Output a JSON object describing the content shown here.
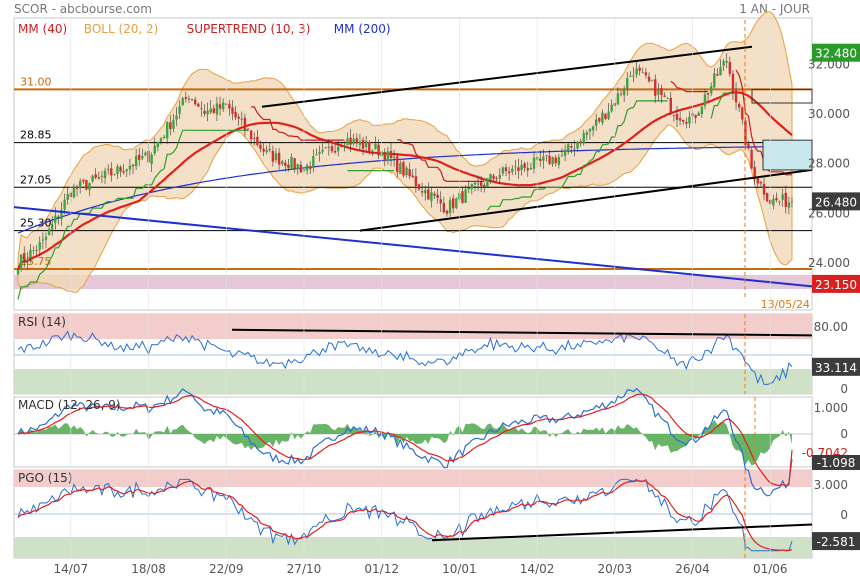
{
  "header": {
    "title": "SCOR - abcbourse.com",
    "period": "1 AN - JOUR"
  },
  "colors": {
    "mm40": "#e0201a",
    "boll": "#e8a040",
    "supertrend_up": "#2e9e2e",
    "supertrend_down": "#c81e1e",
    "mm200": "#1f2fd0",
    "candle_up": "#3fa33f",
    "candle_down": "#d23030",
    "price_badge": "#d82020",
    "last_badge": "#2a9a2a",
    "neutral_badge": "#3c3c3c",
    "rsi_line": "#2a6fd1",
    "signal_line": "#e02020",
    "zone_top": "#f4c8c8",
    "zone_bottom": "#cfe2c8"
  },
  "price_panel": {
    "legend": [
      {
        "label": "MM (40)",
        "color": "#d22020"
      },
      {
        "label": "BOLL (20, 2)",
        "color": "#e8a040"
      },
      {
        "label": "SUPERTREND (10, 3)",
        "color": "#c81e1e"
      },
      {
        "label": "MM (200)",
        "color": "#2030c8"
      }
    ],
    "levels": [
      {
        "label": "31.00",
        "value": 31.0,
        "color": "#c66a10"
      },
      {
        "label": "28.85",
        "value": 28.85,
        "color": "#000000"
      },
      {
        "label": "27.05",
        "value": 27.05,
        "color": "#000000"
      },
      {
        "label": "25.30",
        "value": 25.3,
        "color": "#000000"
      },
      {
        "label": "23.75",
        "value": 23.75,
        "color": "#c66a10"
      }
    ],
    "y_ticks": [
      "32.000",
      "30.000",
      "28.000",
      "26.000",
      "24.000"
    ],
    "badges": [
      {
        "label": "32.480",
        "value": 32.48,
        "color": "#2a9a2a"
      },
      {
        "label": "26.480",
        "value": 26.48,
        "color": "#3c3c3c"
      },
      {
        "label": "23.150",
        "value": 23.15,
        "color": "#d82020"
      }
    ],
    "event_label": "13/05/24"
  },
  "rsi_panel": {
    "legend": "RSI (14)",
    "ticks": [
      "80.00",
      "0"
    ],
    "badge": "33.114"
  },
  "macd_panel": {
    "legend": "MACD (12, 26, 9)",
    "ticks": [
      "1.000",
      "0"
    ],
    "badges": [
      "-0.7042",
      "-1.098"
    ]
  },
  "pgo_panel": {
    "legend": "PGO (15)",
    "ticks": [
      "3.000",
      "0"
    ],
    "badge": "-2.581"
  },
  "x_axis": {
    "labels": [
      "14/07",
      "18/08",
      "22/09",
      "27/10",
      "01/12",
      "10/01",
      "14/02",
      "20/03",
      "26/04",
      "01/06"
    ]
  },
  "chart_data": {
    "type": "candlestick",
    "title": "SCOR - abcbourse.com",
    "period": "1 AN - JOUR",
    "ylim": [
      22.5,
      33.8
    ],
    "categories": [
      "14/07",
      "18/08",
      "22/09",
      "27/10",
      "01/12",
      "10/01",
      "14/02",
      "20/03",
      "26/04",
      "01/06"
    ],
    "close_by_label": [
      26.9,
      28.3,
      30.3,
      27.8,
      28.5,
      26.6,
      28.0,
      30.5,
      29.8,
      26.5
    ],
    "series": [
      {
        "name": "MM (40)",
        "values": [
          25.8,
          28.0,
          29.4,
          28.9,
          28.2,
          27.3,
          27.5,
          28.8,
          29.6,
          29.3
        ]
      },
      {
        "name": "MM (200)",
        "values": [
          25.4,
          26.8,
          27.5,
          27.6,
          27.8,
          28.0,
          28.2,
          28.4,
          28.6,
          28.8
        ]
      }
    ],
    "last_close": 26.48,
    "period_high": 32.48,
    "period_low": 23.15,
    "levels": [
      31.0,
      28.85,
      27.05,
      25.3,
      23.75
    ],
    "rsi_last": 33.114,
    "macd_last": -1.098,
    "macd_signal_last": -0.7042,
    "pgo_last": -2.581
  }
}
